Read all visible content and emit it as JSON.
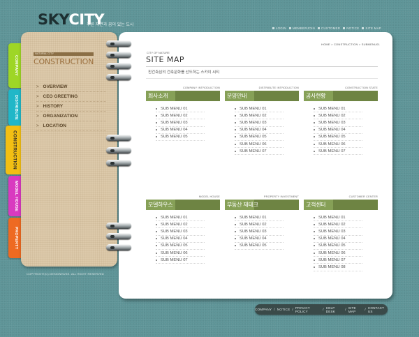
{
  "brand": {
    "sky": "SKY",
    "city": "CITY",
    "tagline": "푸른 자연과 꿈이 있는 도시"
  },
  "top_nav": [
    "LOGIN",
    "MEMBERJOIN",
    "CUSTOMER",
    "NOTICE",
    "SITE MAP"
  ],
  "tabs": [
    {
      "label": "COMPANY",
      "color": "#9ed626"
    },
    {
      "label": "DISTRIBUTE",
      "color": "#21b7c8"
    },
    {
      "label": "CONSTRUCTION",
      "color": "#f2bf13"
    },
    {
      "label": "MODEL HOUSE",
      "color": "#d93ac0"
    },
    {
      "label": "PROPERTY",
      "color": "#ee6a22"
    }
  ],
  "cover": {
    "small": "NATURAL CITY",
    "title": "CONSTRUCTION",
    "nav": [
      "OVERVIEW",
      "CEO GREETING",
      "HISTORY",
      "ORGANIZATION",
      "LOCATION"
    ]
  },
  "copyright": "COPYRIGHT(C) DESIGNHUSE. ALL RIGHT RESERVED",
  "breadcrumb": "HOME > CONSTRUCTION > SUBMENU01",
  "sitemap": {
    "small": "CITY OF NATURE",
    "title": "SITE MAP",
    "subtitle": "친건축심의 건축문화를 선도하는 스카이 씨티"
  },
  "sections": [
    {
      "en": "COMPANY INTRODUCTION",
      "ko": "회사소개",
      "items": [
        "SUB MENU 01",
        "SUB MENU 02",
        "SUB MENU 03",
        "SUB MENU 04",
        "SUB MENU 05"
      ]
    },
    {
      "en": "DISTRIBUTE INTRODUCTION",
      "ko": "분양안내",
      "items": [
        "SUB MENU 01",
        "SUB MENU 02",
        "SUB MENU 03",
        "SUB MENU 04",
        "SUB MENU 05",
        "SUB MENU 06",
        "SUB MENU 07"
      ]
    },
    {
      "en": "CONSTRUCTION STATE",
      "ko": "공사현황",
      "items": [
        "SUB MENU 01",
        "SUB MENU 02",
        "SUB MENU 03",
        "SUB MENU 04",
        "SUB MENU 05",
        "SUB MENU 06",
        "SUB MENU 07"
      ]
    },
    {
      "en": "MODEL HOUSE",
      "ko": "모델하우스",
      "items": [
        "SUB MENU 01",
        "SUB MENU 02",
        "SUB MENU 03",
        "SUB MENU 04",
        "SUB MENU 05",
        "SUB MENU 06",
        "SUB MENU 07"
      ]
    },
    {
      "en": "PROPERTY INVESTMENT",
      "ko": "부동산 재테크",
      "items": [
        "SUB MENU 01",
        "SUB MENU 02",
        "SUB MENU 03",
        "SUB MENU 04",
        "SUB MENU 05"
      ]
    },
    {
      "en": "CUSTOMER CENTER",
      "ko": "고객센터",
      "items": [
        "SUB MENU 01",
        "SUB MENU 02",
        "SUB MENU 03",
        "SUB MENU 04",
        "SUB MENU 05",
        "SUB MENU 06",
        "SUB MENU 07",
        "SUB MENU 08"
      ]
    }
  ],
  "footer_nav": [
    "COMPANY",
    "NOTICE",
    "PRIVACY POLICY",
    "HELP DESK",
    "SITE MAP",
    "CONTACT US"
  ]
}
